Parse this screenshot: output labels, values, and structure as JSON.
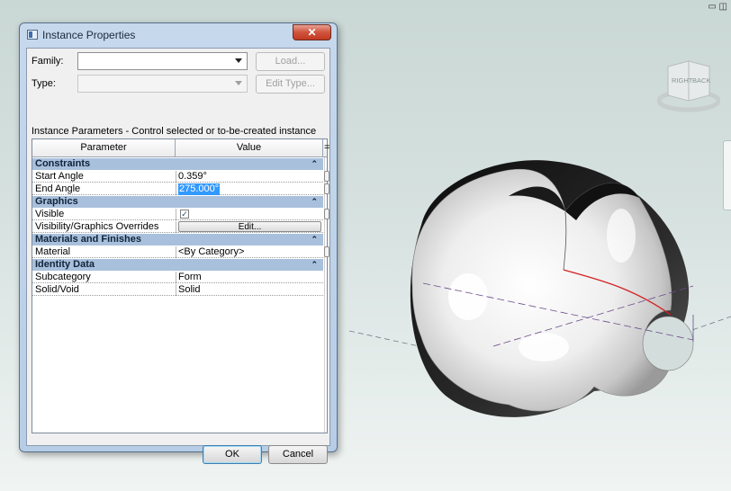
{
  "window_controls": "▭ ◫",
  "viewcube": {
    "faces": [
      "RIGHT",
      "BACK"
    ]
  },
  "dialog": {
    "title": "Instance Properties",
    "close_label": "✕",
    "family_label": "Family:",
    "family_value": "",
    "load_button": "Load...",
    "type_label": "Type:",
    "type_value": "",
    "edit_type_button": "Edit Type...",
    "subtitle": "Instance Parameters - Control selected or to-be-created instance",
    "columns": {
      "parameter": "Parameter",
      "value": "Value",
      "sort": "="
    },
    "groups": [
      {
        "name": "Constraints",
        "rows": [
          {
            "param": "Start Angle",
            "value": "0.359°"
          },
          {
            "param": "End Angle",
            "value": "275.000°"
          }
        ]
      },
      {
        "name": "Graphics",
        "rows": [
          {
            "param": "Visible",
            "value": "✓"
          },
          {
            "param": "Visibility/Graphics Overrides",
            "value": "Edit..."
          }
        ]
      },
      {
        "name": "Materials and Finishes",
        "rows": [
          {
            "param": "Material",
            "value": "<By Category>"
          }
        ]
      },
      {
        "name": "Identity Data",
        "rows": [
          {
            "param": "Subcategory",
            "value": "Form"
          },
          {
            "param": "Solid/Void",
            "value": "Solid"
          }
        ]
      }
    ],
    "group_caret": "⌃",
    "ok_button": "OK",
    "cancel_button": "Cancel"
  },
  "colors": {
    "dialog_frame": "#b7cde6",
    "group_header": "#a8c0dc",
    "selection": "#3399ff",
    "close_button": "#c23a22"
  }
}
